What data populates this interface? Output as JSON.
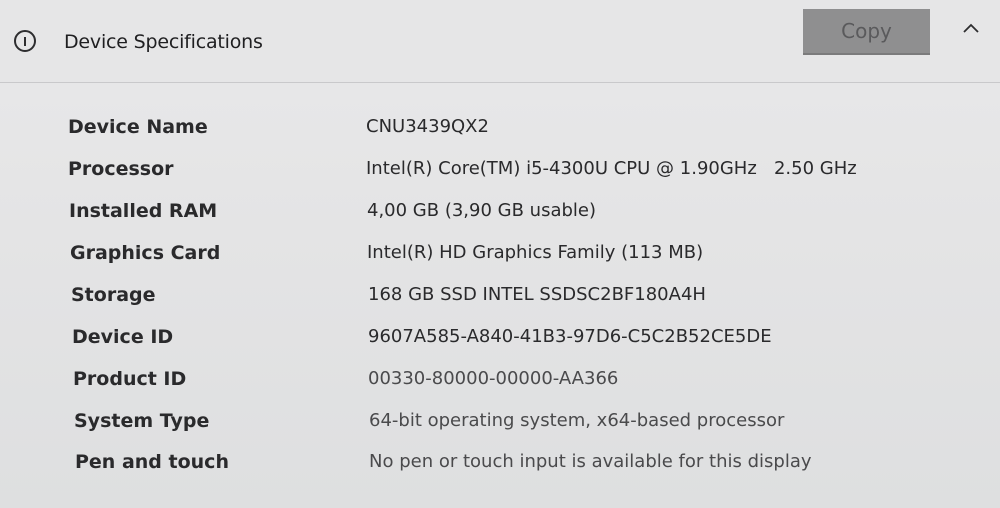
{
  "header": {
    "title": "Device Specifications",
    "copy_label": "Copy",
    "icon": "info-icon",
    "collapse_icon": "chevron-up-icon"
  },
  "specs": [
    {
      "label": "Device Name",
      "value": "CNU3439QX2"
    },
    {
      "label": "Processor",
      "value": "Intel(R) Core(TM) i5-4300U CPU @ 1.90GHz   2.50 GHz"
    },
    {
      "label": "Installed RAM",
      "value": "4,00 GB (3,90 GB usable)"
    },
    {
      "label": "Graphics Card",
      "value": "Intel(R) HD Graphics Family (113 MB)"
    },
    {
      "label": "Storage",
      "value": "168 GB SSD INTEL SSDSC2BF180A4H"
    },
    {
      "label": "Device ID",
      "value": "9607A585-A840-41B3-97D6-C5C2B52CE5DE"
    },
    {
      "label": "Product ID",
      "value": "00330-80000-00000-AA366"
    },
    {
      "label": "System Type",
      "value": "64-bit operating system, x64-based processor"
    },
    {
      "label": "Pen and touch",
      "value": "No pen or touch input is available for this display"
    }
  ],
  "colors": {
    "background": "#e6e6e7",
    "button": "#8f8f90",
    "text": "#2a2a2c"
  }
}
